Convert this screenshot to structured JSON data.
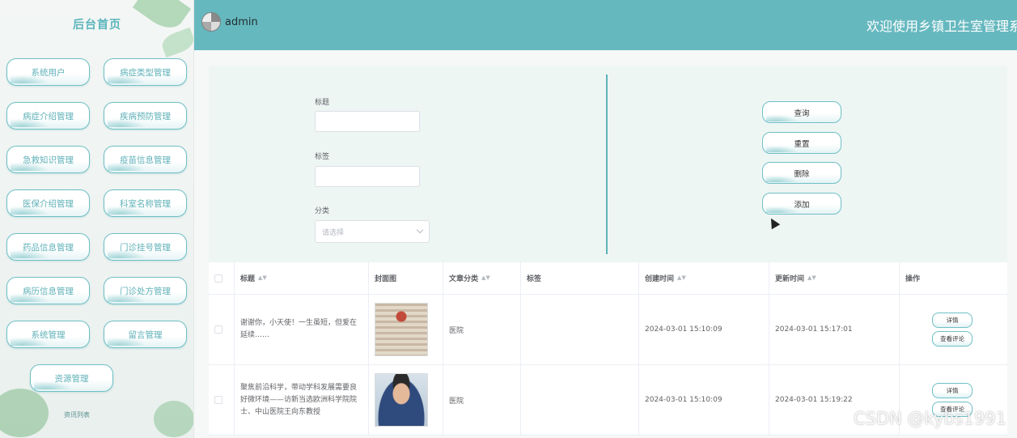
{
  "sidebar": {
    "title": "后台首页",
    "menu": [
      "系统用户",
      "病症类型管理",
      "病症介绍管理",
      "疾病预防管理",
      "急救知识管理",
      "疫苗信息管理",
      "医保介绍管理",
      "科室名称管理",
      "药品信息管理",
      "门诊挂号管理",
      "病历信息管理",
      "门诊处方管理",
      "系统管理",
      "留言管理",
      "资源管理"
    ],
    "sub_label": "资讯列表"
  },
  "header": {
    "username": "admin",
    "welcome": "欢迎使用乡镇卫生室管理系统"
  },
  "search": {
    "title_label": "标题",
    "tag_label": "标签",
    "category_label": "分类",
    "category_placeholder": "请选择",
    "buttons": {
      "query": "查询",
      "reset": "重置",
      "delete": "删除",
      "add": "添加"
    }
  },
  "table": {
    "headers": [
      "标题",
      "封面图",
      "文章分类",
      "标签",
      "创建时间",
      "更新时间",
      "操作"
    ],
    "rows": [
      {
        "title": "谢谢你，小天使！一生虽短，但爱在延续……",
        "category": "医院",
        "tag": "",
        "created": "2024-03-01 15:10:09",
        "updated": "2024-03-01 15:17:01",
        "thumb": "certificate"
      },
      {
        "title": "聚焦前沿科学，带动学科发展需要良好微环境——访新当选欧洲科学院院士、中山医院王向东教授",
        "category": "医院",
        "tag": "",
        "created": "2024-03-01 15:10:09",
        "updated": "2024-03-01 15:19:22",
        "thumb": "portrait"
      }
    ],
    "row_actions": {
      "detail": "详情",
      "comments": "查看评论"
    }
  },
  "watermark": "CSDN @kybs1991",
  "colors": {
    "header": "#66b8bf",
    "accent": "#5fb3b9",
    "panel": "#eef6f4"
  }
}
